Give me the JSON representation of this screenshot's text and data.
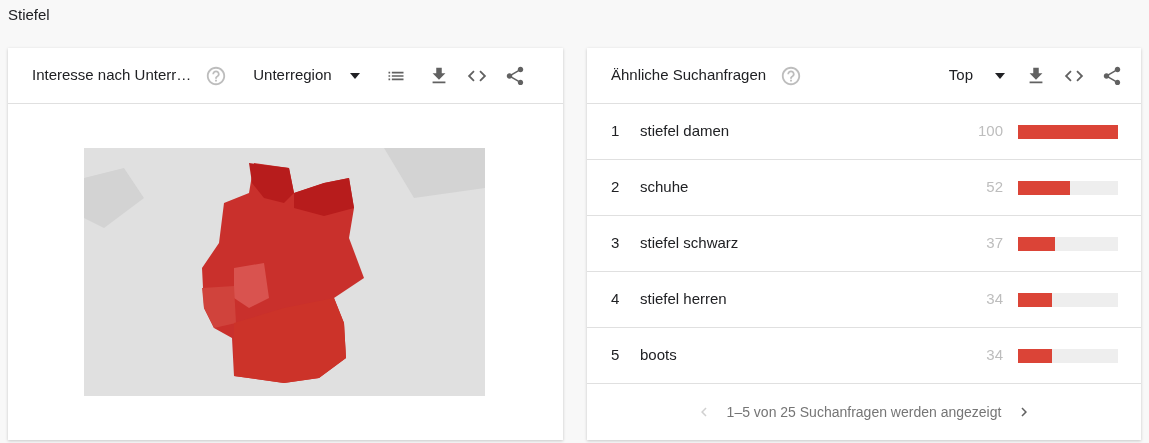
{
  "page_title": "Stiefel",
  "region_card": {
    "title": "Interesse nach Unterr…",
    "dropdown": "Unterregion"
  },
  "queries_card": {
    "title": "Ähnliche Suchanfragen",
    "dropdown": "Top",
    "rows": [
      {
        "rank": "1",
        "query": "stiefel damen",
        "value": "100",
        "level": 1.0
      },
      {
        "rank": "2",
        "query": "schuhe",
        "value": "52",
        "level": 0.52
      },
      {
        "rank": "3",
        "query": "stiefel schwarz",
        "value": "37",
        "level": 0.37
      },
      {
        "rank": "4",
        "query": "stiefel herren",
        "value": "34",
        "level": 0.34
      },
      {
        "rank": "5",
        "query": "boots",
        "value": "34",
        "level": 0.34
      }
    ],
    "pagination": {
      "text": "1–5 von 25 Suchanfragen werden angezeigt",
      "prev_enabled": false,
      "next_enabled": true
    }
  }
}
